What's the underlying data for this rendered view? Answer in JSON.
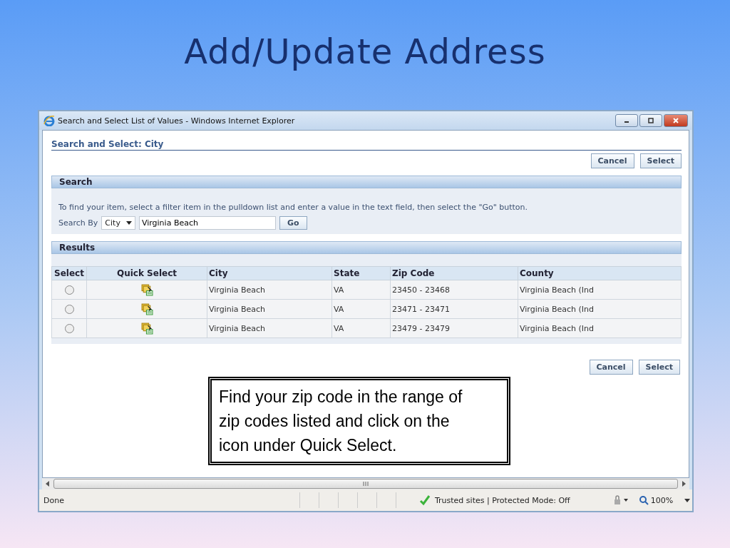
{
  "slide": {
    "title": "Add/Update Address"
  },
  "window": {
    "title": "Search and Select List of Values - Windows Internet Explorer"
  },
  "page": {
    "heading": "Search and Select: City",
    "top_buttons": [
      "Cancel",
      "Select"
    ],
    "search": {
      "header": "Search",
      "instructions": "To find your item, select a filter item in the pulldown list and enter a value in the text field, then select the \"Go\" button.",
      "search_by_label": "Search By",
      "filter": "City",
      "value": "Virginia Beach",
      "go": "Go"
    },
    "results": {
      "header": "Results",
      "columns": [
        "Select",
        "Quick Select",
        "City",
        "State",
        "Zip Code",
        "County"
      ],
      "rows": [
        {
          "selected": false,
          "city": "Virginia Beach",
          "state": "VA",
          "zip_code": "23450 - 23468",
          "county": "Virginia Beach (Ind"
        },
        {
          "selected": false,
          "city": "Virginia Beach",
          "state": "VA",
          "zip_code": "23471 - 23471",
          "county": "Virginia Beach (Ind"
        },
        {
          "selected": false,
          "city": "Virginia Beach",
          "state": "VA",
          "zip_code": "23479 - 23479",
          "county": "Virginia Beach (Ind"
        }
      ]
    },
    "bottom_buttons": [
      "Cancel",
      "Select"
    ]
  },
  "callout": "Find your zip code in the range of zip codes listed and click on the icon under Quick Select.",
  "status_bar": {
    "status": "Done",
    "zone": "Trusted sites | Protected Mode: Off",
    "zoom": "100%"
  }
}
